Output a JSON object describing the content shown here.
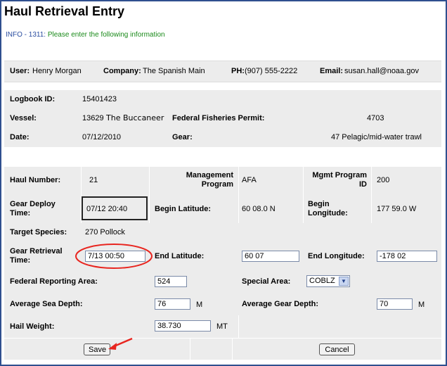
{
  "page": {
    "title": "Haul Retrieval Entry",
    "info_code": "INFO - 1311:",
    "info_text": "Please enter the following information"
  },
  "user_bar": {
    "user_label": "User:",
    "user_value": "Henry Morgan",
    "company_label": "Company:",
    "company_value": "The Spanish Main",
    "ph_label": "PH:",
    "ph_value": "(907) 555-2222",
    "email_label": "Email:",
    "email_value": "susan.hall@noaa.gov"
  },
  "logbook": {
    "logbook_label": "Logbook ID:",
    "logbook_value": "15401423",
    "vessel_label": "Vessel:",
    "vessel_id": "13629",
    "vessel_name": "The Buccaneer",
    "permit_label": "Federal Fisheries Permit:",
    "permit_value": "4703",
    "date_label": "Date:",
    "date_value": "07/12/2010",
    "gear_label": "Gear:",
    "gear_value": "47 Pelagic/mid-water trawl"
  },
  "haul": {
    "haul_number_label": "Haul Number:",
    "haul_number_value": "21",
    "mgmt_program_label_1": "Management",
    "mgmt_program_label_2": "Program",
    "mgmt_program_value": "AFA",
    "mgmt_id_label_1": "Mgmt Program",
    "mgmt_id_label_2": "ID",
    "mgmt_id_value": "200",
    "deploy_label_1": "Gear Deploy",
    "deploy_label_2": "Time:",
    "deploy_value": "07/12 20:40",
    "begin_lat_label": "Begin Latitude:",
    "begin_lat_value": "60 08.0 N",
    "begin_lon_label_1": "Begin",
    "begin_lon_label_2": "Longitude:",
    "begin_lon_value": "177 59.0 W",
    "target_label": "Target Species:",
    "target_value": "270 Pollock",
    "retrieval_label_1": "Gear Retrieval",
    "retrieval_label_2": "Time:",
    "retrieval_value": "7/13 00:50",
    "end_lat_label": "End Latitude:",
    "end_lat_value": "60 07",
    "end_lon_label": "End Longitude:",
    "end_lon_value": "-178 02",
    "fra_label": "Federal Reporting Area:",
    "fra_value": "524",
    "special_area_label": "Special Area:",
    "special_area_value": "COBLZ",
    "sea_depth_label": "Average Sea Depth:",
    "sea_depth_value": "76",
    "sea_depth_unit": "M",
    "gear_depth_label": "Average Gear Depth:",
    "gear_depth_value": "70",
    "gear_depth_unit": "M",
    "hail_label": "Hail Weight:",
    "hail_value": "38.730",
    "hail_unit": "MT"
  },
  "buttons": {
    "save": "Save",
    "cancel": "Cancel"
  },
  "colors": {
    "annotation": "#e8251f",
    "frame": "#2f4f8f",
    "info_green": "#1a8a1a",
    "info_blue": "#2a4da0"
  }
}
